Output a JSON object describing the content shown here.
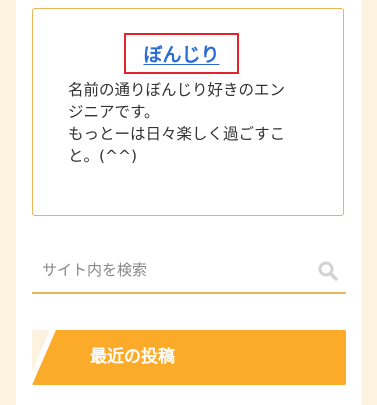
{
  "profile": {
    "name": "ぼんじり",
    "description_lines": [
      "名前の通りぼんじり好きのエン",
      "ジニアです。",
      "もっとーは日々楽しく過ごすこ",
      "と。(^^)"
    ]
  },
  "search": {
    "placeholder": "サイト内を検索",
    "value": "",
    "icon": "search-icon"
  },
  "recent_posts": {
    "title": "最近の投稿"
  },
  "colors": {
    "page_background": "#fdf2e0",
    "card_border": "#e6b45a",
    "highlight_border": "#e0242a",
    "link": "#2a6cd4",
    "accent_orange": "#fcaa2a"
  }
}
